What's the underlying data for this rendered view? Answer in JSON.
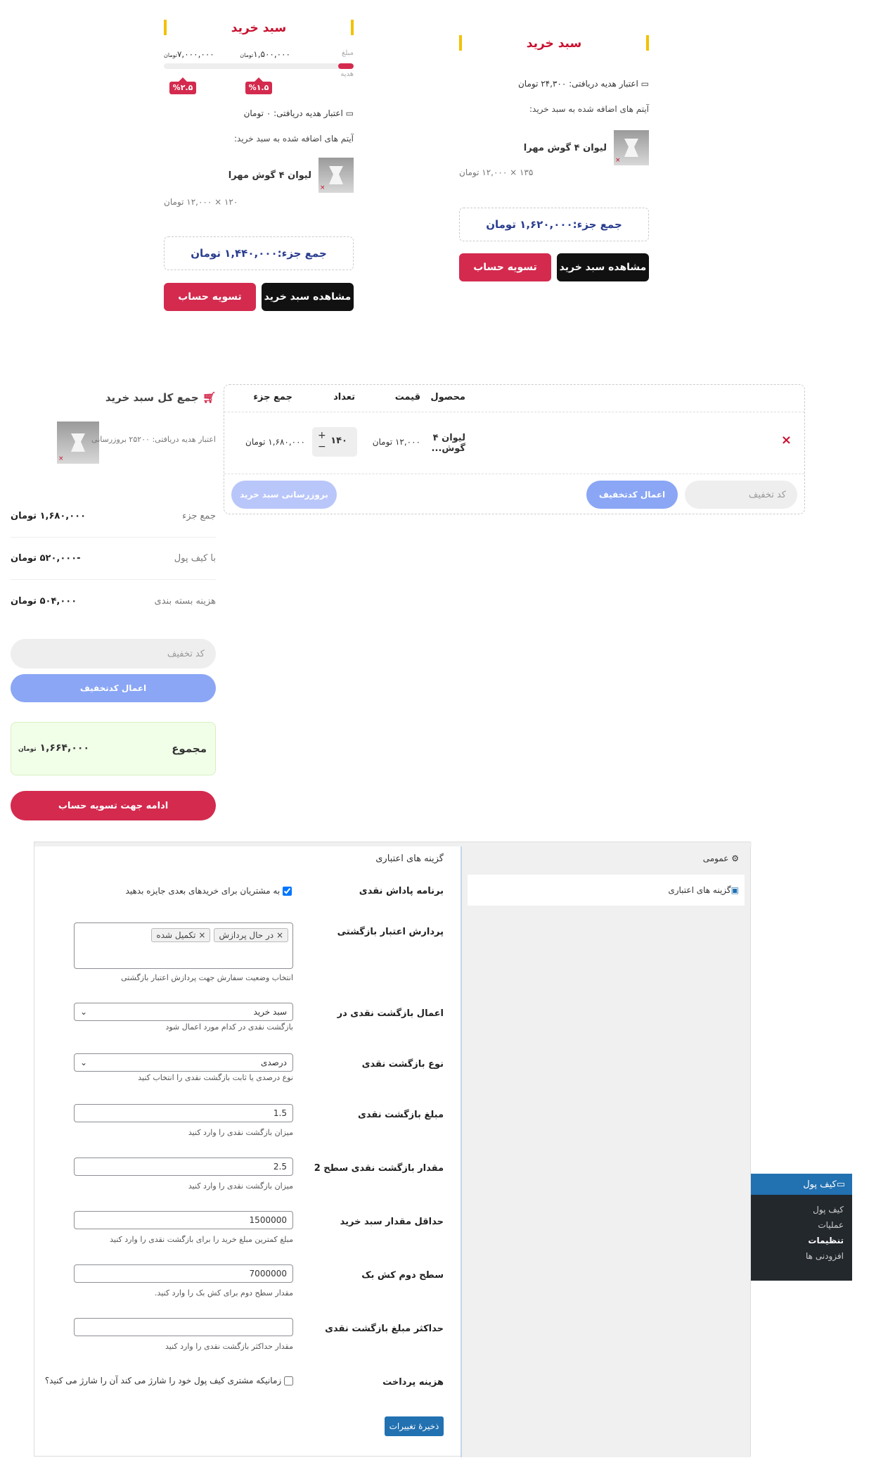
{
  "mini_cart_a": {
    "title": "سبد خرید",
    "progress_label1": "مبلغ",
    "progress_label2": "هدیه",
    "amount_low": "۱,۵۰۰,۰۰۰",
    "amount_low_unit": "تومان",
    "amount_high": "۷,۰۰۰,۰۰۰",
    "amount_high_unit": "تومان",
    "progress": 0.08,
    "badge_low": "%۱.۵",
    "badge_high": "%۲.۵",
    "gift_credit": "اعتبار هدیه دریافتی: ۰ تومان",
    "items_label": "آیتم های اضافه شده به سبد خرید:",
    "product_name": "لیوان ۴ گوش مهرا",
    "qty_line": "۱۲۰ × ۱۲,۰۰۰ تومان",
    "subtotal": "جمع جزء:۱,۴۴۰,۰۰۰ تومان",
    "view_cart": "مشاهده سبد خرید",
    "checkout": "تسویه حساب"
  },
  "mini_cart_b": {
    "title": "سبد خرید",
    "gift_credit": "اعتبار هدیه دریافتی: ۲۴,۳۰۰ تومان",
    "items_label": "آیتم های اضافه شده به سبد خرید:",
    "product_name": "لیوان ۴ گوش مهرا",
    "qty_line": "۱۳۵ × ۱۲,۰۰۰ تومان",
    "subtotal": "جمع جزء:۱,۶۲۰,۰۰۰ تومان",
    "view_cart": "مشاهده سبد خرید",
    "checkout": "تسویه حساب"
  },
  "cart_table": {
    "headers": {
      "product": "محصول",
      "price": "قیمت",
      "qty": "تعداد",
      "subtotal": "جمع جزء"
    },
    "row": {
      "name": "لیوان ۴ گوش...",
      "price": "۱۲,۰۰۰ تومان",
      "qty": "۱۴۰",
      "subtotal": "۱,۶۸۰,۰۰۰ تومان",
      "plus": "+",
      "minus": "−",
      "remove": "×"
    },
    "coupon_placeholder": "کد تخفیف",
    "apply_coupon": "اعمال کدتخفیف",
    "update_cart": "بروزرسانی سبد خرید"
  },
  "cart_totals": {
    "title": "جمع کل سبد خرید",
    "gift_note": "اعتبار هدیه دریافتی: ۲۵۲۰۰ بروزرسانی",
    "rows": [
      {
        "label": "جمع جزء",
        "value": "۱,۶۸۰,۰۰۰ تومان"
      },
      {
        "label": "با کیف پول",
        "value": "-۵۲۰,۰۰۰ تومان"
      },
      {
        "label": "هزینه بسته بندی",
        "value": "۵۰۴,۰۰۰ تومان"
      }
    ],
    "coupon_placeholder": "کد تخفیف",
    "apply_coupon": "اعمال کدتخفیف",
    "total_label": "مجموع",
    "total_value": "۱,۶۶۴,۰۰۰",
    "total_unit": "تومان",
    "proceed": "ادامه جهت تسویه حساب"
  },
  "admin": {
    "tab_general": "عمومی",
    "tab_credit": "گزینه های اعتباری",
    "section_title": "گزینه های اعتباری",
    "rows": {
      "reward_label": "برنامه پاداش نقدی",
      "reward_text": "به مشتریان برای خریدهای بعدی جایزه بدهید",
      "process_label": "پردارش اعتبار بازگشتی",
      "chip1": "در حال پردازش",
      "chip2": "تکمیل شده",
      "process_help": "انتخاب وضعیت سفارش جهت پردازش اعتبار بازگشتی",
      "apply_label": "اعمال بازگشت نقدی در",
      "apply_value": "سبد خرید",
      "apply_help": "بازگشت نقدی در کدام مورد اعمال شود",
      "type_label": "نوع بازگشت نقدی",
      "type_value": "درصدی",
      "type_help": "نوع درصدی یا ثابت بازگشت نقدی را انتخاب کنید",
      "amount_label": "مبلغ بازگشت نقدی",
      "amount_value": "1.5",
      "amount_help": "میزان بازگشت نقدی را وارد کنید",
      "level2_label": "مقدار بازگشت نقدی سطح 2",
      "level2_value": "2.5",
      "level2_help": "میزان بازگشت نقدی را وارد کنید",
      "min_label": "حداقل مقدار سبد خرید",
      "min_value": "1500000",
      "min_help": "مبلغ کمترین مبلغ خرید را برای بازگشت نقدی را وارد کنید",
      "tier2_label": "سطح دوم کش بک",
      "tier2_value": "7000000",
      "tier2_help": "مقدار سطح دوم برای کش بک را وارد کنید.",
      "max_label": "حداکثر مبلغ بازگشت نقدی",
      "max_value": "",
      "max_help": "مقدار حداکثر بازگشت نقدی را وارد کنید",
      "fee_label": "هزینه پرداخت",
      "fee_text": "زمانیکه مشتری کیف پول خود را شارژ می کند آن را شارژ می کنید؟"
    },
    "save": "ذخیرهٔ تغییرات"
  },
  "wp_menu": {
    "head": "کیف پول",
    "items": [
      "کیف پول",
      "عملیات",
      "تنظیمات",
      "افزودنی ها"
    ]
  },
  "colors": {
    "red": "#d42a4e",
    "blue": "#8aa6f5",
    "navy": "#2a3d8f"
  }
}
